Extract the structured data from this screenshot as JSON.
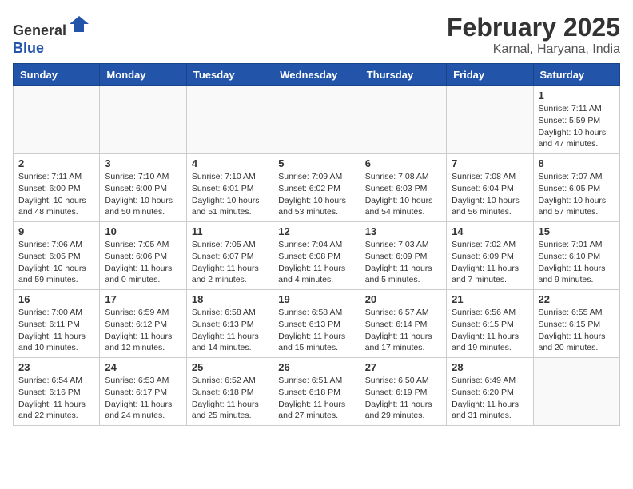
{
  "header": {
    "logo_line1": "General",
    "logo_line2": "Blue",
    "month_year": "February 2025",
    "location": "Karnal, Haryana, India"
  },
  "days_of_week": [
    "Sunday",
    "Monday",
    "Tuesday",
    "Wednesday",
    "Thursday",
    "Friday",
    "Saturday"
  ],
  "weeks": [
    [
      {
        "day": "",
        "info": ""
      },
      {
        "day": "",
        "info": ""
      },
      {
        "day": "",
        "info": ""
      },
      {
        "day": "",
        "info": ""
      },
      {
        "day": "",
        "info": ""
      },
      {
        "day": "",
        "info": ""
      },
      {
        "day": "1",
        "info": "Sunrise: 7:11 AM\nSunset: 5:59 PM\nDaylight: 10 hours and 47 minutes."
      }
    ],
    [
      {
        "day": "2",
        "info": "Sunrise: 7:11 AM\nSunset: 6:00 PM\nDaylight: 10 hours and 48 minutes."
      },
      {
        "day": "3",
        "info": "Sunrise: 7:10 AM\nSunset: 6:00 PM\nDaylight: 10 hours and 50 minutes."
      },
      {
        "day": "4",
        "info": "Sunrise: 7:10 AM\nSunset: 6:01 PM\nDaylight: 10 hours and 51 minutes."
      },
      {
        "day": "5",
        "info": "Sunrise: 7:09 AM\nSunset: 6:02 PM\nDaylight: 10 hours and 53 minutes."
      },
      {
        "day": "6",
        "info": "Sunrise: 7:08 AM\nSunset: 6:03 PM\nDaylight: 10 hours and 54 minutes."
      },
      {
        "day": "7",
        "info": "Sunrise: 7:08 AM\nSunset: 6:04 PM\nDaylight: 10 hours and 56 minutes."
      },
      {
        "day": "8",
        "info": "Sunrise: 7:07 AM\nSunset: 6:05 PM\nDaylight: 10 hours and 57 minutes."
      }
    ],
    [
      {
        "day": "9",
        "info": "Sunrise: 7:06 AM\nSunset: 6:05 PM\nDaylight: 10 hours and 59 minutes."
      },
      {
        "day": "10",
        "info": "Sunrise: 7:05 AM\nSunset: 6:06 PM\nDaylight: 11 hours and 0 minutes."
      },
      {
        "day": "11",
        "info": "Sunrise: 7:05 AM\nSunset: 6:07 PM\nDaylight: 11 hours and 2 minutes."
      },
      {
        "day": "12",
        "info": "Sunrise: 7:04 AM\nSunset: 6:08 PM\nDaylight: 11 hours and 4 minutes."
      },
      {
        "day": "13",
        "info": "Sunrise: 7:03 AM\nSunset: 6:09 PM\nDaylight: 11 hours and 5 minutes."
      },
      {
        "day": "14",
        "info": "Sunrise: 7:02 AM\nSunset: 6:09 PM\nDaylight: 11 hours and 7 minutes."
      },
      {
        "day": "15",
        "info": "Sunrise: 7:01 AM\nSunset: 6:10 PM\nDaylight: 11 hours and 9 minutes."
      }
    ],
    [
      {
        "day": "16",
        "info": "Sunrise: 7:00 AM\nSunset: 6:11 PM\nDaylight: 11 hours and 10 minutes."
      },
      {
        "day": "17",
        "info": "Sunrise: 6:59 AM\nSunset: 6:12 PM\nDaylight: 11 hours and 12 minutes."
      },
      {
        "day": "18",
        "info": "Sunrise: 6:58 AM\nSunset: 6:13 PM\nDaylight: 11 hours and 14 minutes."
      },
      {
        "day": "19",
        "info": "Sunrise: 6:58 AM\nSunset: 6:13 PM\nDaylight: 11 hours and 15 minutes."
      },
      {
        "day": "20",
        "info": "Sunrise: 6:57 AM\nSunset: 6:14 PM\nDaylight: 11 hours and 17 minutes."
      },
      {
        "day": "21",
        "info": "Sunrise: 6:56 AM\nSunset: 6:15 PM\nDaylight: 11 hours and 19 minutes."
      },
      {
        "day": "22",
        "info": "Sunrise: 6:55 AM\nSunset: 6:15 PM\nDaylight: 11 hours and 20 minutes."
      }
    ],
    [
      {
        "day": "23",
        "info": "Sunrise: 6:54 AM\nSunset: 6:16 PM\nDaylight: 11 hours and 22 minutes."
      },
      {
        "day": "24",
        "info": "Sunrise: 6:53 AM\nSunset: 6:17 PM\nDaylight: 11 hours and 24 minutes."
      },
      {
        "day": "25",
        "info": "Sunrise: 6:52 AM\nSunset: 6:18 PM\nDaylight: 11 hours and 25 minutes."
      },
      {
        "day": "26",
        "info": "Sunrise: 6:51 AM\nSunset: 6:18 PM\nDaylight: 11 hours and 27 minutes."
      },
      {
        "day": "27",
        "info": "Sunrise: 6:50 AM\nSunset: 6:19 PM\nDaylight: 11 hours and 29 minutes."
      },
      {
        "day": "28",
        "info": "Sunrise: 6:49 AM\nSunset: 6:20 PM\nDaylight: 11 hours and 31 minutes."
      },
      {
        "day": "",
        "info": ""
      }
    ]
  ]
}
